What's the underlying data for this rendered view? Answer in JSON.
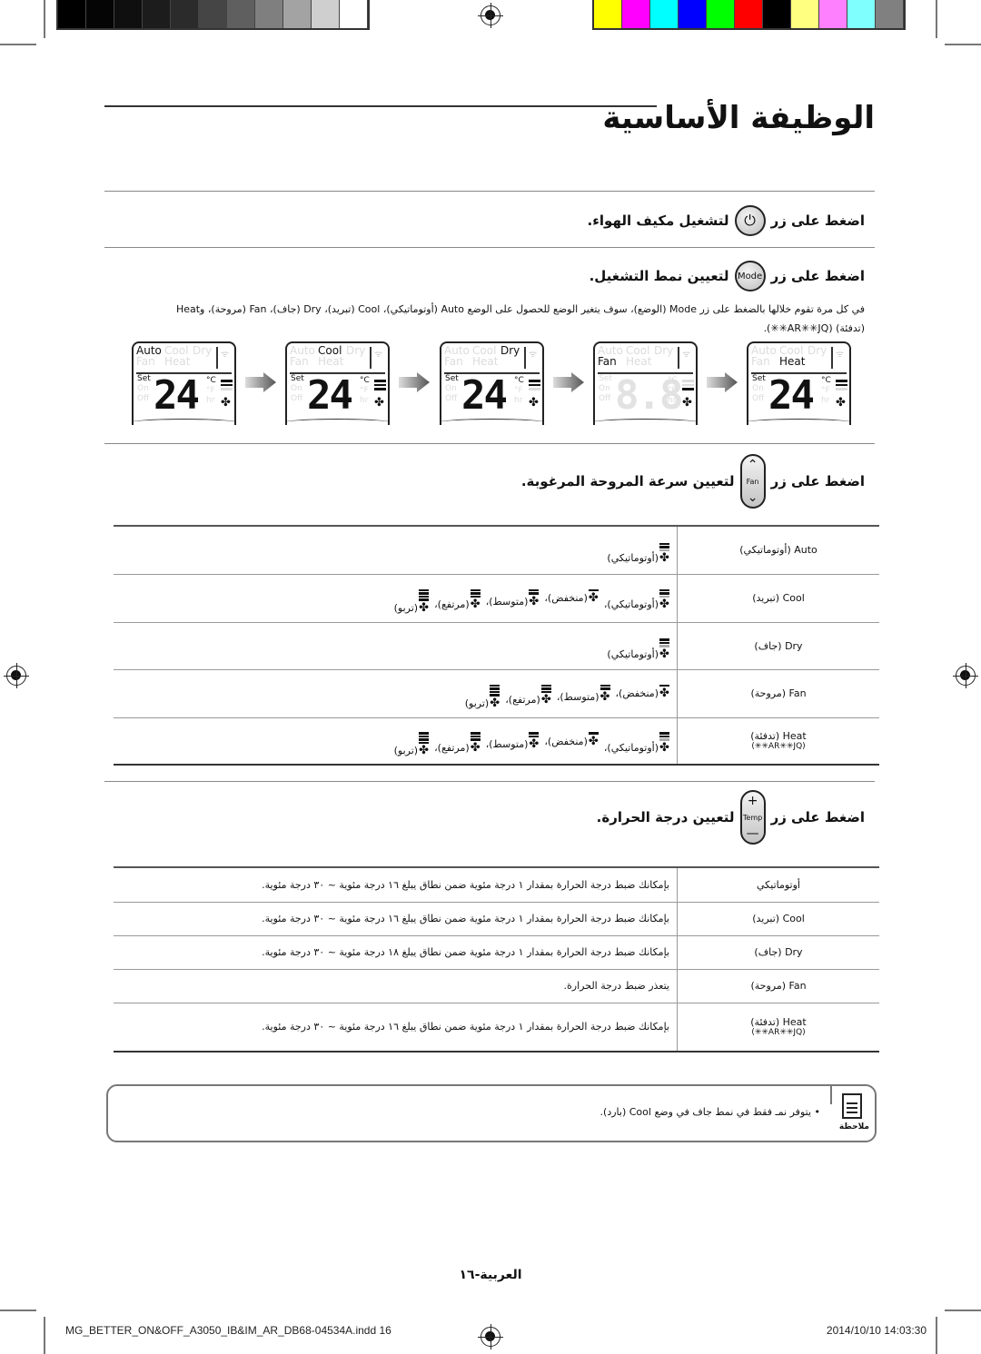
{
  "print_marks": {
    "grayscale": [
      "#000000",
      "#050505",
      "#0f0f0f",
      "#1c1c1c",
      "#2b2b2b",
      "#454545",
      "#5f5f5f",
      "#7f7f7f",
      "#a3a3a3",
      "#cfcfcf",
      "#ffffff"
    ],
    "colors": [
      "#ffff00",
      "#ff00ff",
      "#00ffff",
      "#0000ff",
      "#00ff00",
      "#ff0000",
      "#000000",
      "#ffff80",
      "#ff80ff",
      "#80ffff",
      "#808080"
    ]
  },
  "title": "الوظيفة الأساسية",
  "steps": {
    "power": {
      "before": "اضغط على زر",
      "after": "لتشغيل مكيف الهواء.",
      "button_label": "⏻"
    },
    "mode": {
      "before": "اضغط على زر",
      "after": "لتعيين نمط التشغيل.",
      "button_label": "Mode"
    },
    "mode_desc_line1": "في كل مرة تقوم خلالها بالضغط على زر Mode (الوضع)، سوف يتغير الوضع للحصول على الوضع Auto (أوتوماتيكي)، Cool (تبريد)، Dry (جاف)، Fan (مروحة)، وHeat",
    "mode_desc_line2": "(تدفئة) (AR✳✳JQ✳✳).",
    "fan": {
      "before": "اضغط على زر",
      "after": "لتعيين سرعة المروحة المرغوبة.",
      "button_label": "Fan",
      "up": "⌃",
      "down": "⌄"
    },
    "temp": {
      "before": "اضغط على زر",
      "after": "لتعيين درجة الحرارة.",
      "button_label": "Temp",
      "up": "+",
      "down": "—"
    }
  },
  "lcd": {
    "mode_words": [
      "Auto",
      "Cool",
      "Dry",
      "Fan",
      "Heat"
    ],
    "side_labels": [
      "Set",
      "On",
      "Off"
    ],
    "units": [
      "°C",
      "°F",
      "hr"
    ],
    "fan_icon": "✤",
    "wifi_icon": "ᯤ",
    "panels": [
      {
        "active": "Auto",
        "temp": "24",
        "show_set": true,
        "bars_on": [
          true,
          true,
          false
        ]
      },
      {
        "active": "Cool",
        "temp": "24",
        "show_set": true,
        "bars_on": [
          true,
          true,
          true
        ]
      },
      {
        "active": "Dry",
        "temp": "24",
        "show_set": true,
        "bars_on": [
          true,
          true,
          false
        ]
      },
      {
        "active": "Fan",
        "temp": "8.8",
        "show_set": false,
        "bars_on": [
          false,
          false,
          true
        ]
      },
      {
        "active": "Heat",
        "temp": "24",
        "show_set": true,
        "bars_on": [
          true,
          true,
          false
        ]
      }
    ]
  },
  "fan_table": [
    {
      "mode": "Auto (أوتوماتيكي)",
      "speeds": [
        "(أوتوماتيكي)"
      ]
    },
    {
      "mode": "Cool (تبريد)",
      "speeds": [
        "(أوتوماتيكي)،",
        "(منخفض)،",
        "(متوسط)،",
        "(مرتفع)،",
        "(تربو)"
      ]
    },
    {
      "mode": "Dry (جاف)",
      "speeds": [
        "(أوتوماتيكي)"
      ]
    },
    {
      "mode": "Fan (مروحة)",
      "speeds": [
        "(منخفض)،",
        "(متوسط)،",
        "(مرتفع)،",
        "(تربو)"
      ]
    },
    {
      "mode": "Heat (تدفئة)",
      "mode_sub": "(AR✳✳JQ✳✳)",
      "speeds": [
        "(أوتوماتيكي)،",
        "(منخفض)،",
        "(متوسط)،",
        "(مرتفع)،",
        "(تربو)"
      ]
    }
  ],
  "temp_table": [
    {
      "mode": "أوتوماتيكي",
      "desc": "بإمكانك ضبط درجة الحرارة بمقدار ١ درجة مئوية ضمن نطاق يبلغ ١٦ درجة مئوية ~ ٣٠ درجة مئوية."
    },
    {
      "mode": "Cool (تبريد)",
      "desc": "بإمكانك ضبط درجة الحرارة بمقدار ١ درجة مئوية ضمن نطاق يبلغ ١٦ درجة مئوية ~ ٣٠ درجة مئوية."
    },
    {
      "mode": "Dry (جاف)",
      "desc": "بإمكانك ضبط درجة الحرارة بمقدار ١ درجة مئوية ضمن نطاق يبلغ ١٨ درجة مئوية ~ ٣٠ درجة مئوية."
    },
    {
      "mode": "Fan (مروحة)",
      "desc": "يتعذر ضبط درجة الحرارة."
    },
    {
      "mode": "Heat (تدفئة)",
      "mode_sub": "(AR✳✳JQ✳✳)",
      "desc": "بإمكانك ضبط درجة الحرارة بمقدار ١ درجة مئوية ضمن نطاق يبلغ ١٦ درجة مئوية ~ ٣٠ درجة مئوية."
    }
  ],
  "note": {
    "label": "ملاحظة",
    "text": "•   يتوفر نمـ فقط في نمط جاف في وضع Cool (بارد)."
  },
  "page_number": "العربية-١٦",
  "footer": {
    "file": "MG_BETTER_ON&OFF_A3050_IB&IM_AR_DB68-04534A.indd   16",
    "timestamp": "2014/10/10   14:03:30"
  }
}
